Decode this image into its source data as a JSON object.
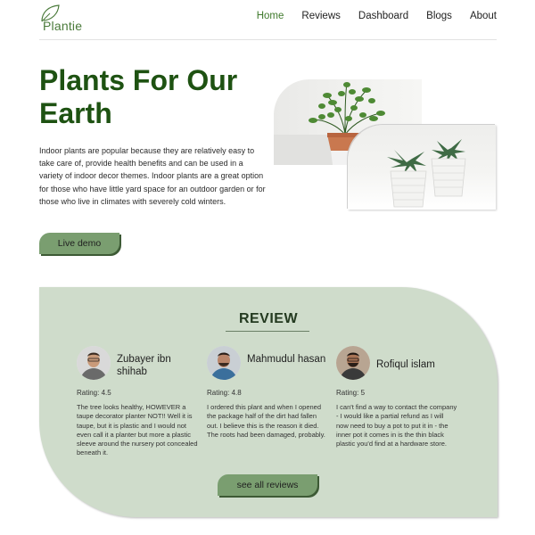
{
  "brand": {
    "name": "Plantie",
    "accent": "#1e5212",
    "button": "#7a9e70",
    "section_bg": "#cfdccb",
    "logo_icon": "leaf-icon"
  },
  "nav": {
    "items": [
      {
        "label": "Home",
        "active": true
      },
      {
        "label": "Reviews",
        "active": false
      },
      {
        "label": "Dashboard",
        "active": false
      },
      {
        "label": "Blogs",
        "active": false
      },
      {
        "label": "About",
        "active": false
      }
    ]
  },
  "hero": {
    "title": "Plants For Our Earth",
    "description": "Indoor plants are popular because they are relatively easy to take care of, provide health benefits and can be used in a variety of indoor decor themes. Indoor plants are a great option for those who have little yard space for an outdoor garden or for those who live in climates with severely cold winters.",
    "button_label": "Live demo"
  },
  "review": {
    "title": "REVIEW",
    "cards": [
      {
        "name": "Zubayer ibn shihab",
        "rating": "Rating: 4.5",
        "text": "The tree looks healthy, HOWEVER a taupe decorator planter NOT!! Well it is taupe, but it is plastic and I would not even call it a planter but more a plastic sleeve around the nursery pot concealed beneath it."
      },
      {
        "name": "Mahmudul hasan",
        "rating": "Rating: 4.8",
        "text": "I ordered this plant and when I opened the package half of the dirt had fallen out. I believe this is the reason it died. The roots had been damaged, probably."
      },
      {
        "name": "Rofiqul islam",
        "rating": "Rating: 5",
        "text": "I can't find a way to contact the company - I would like a partial refund as I will now need to buy a pot to put it in - the inner pot it comes in is the thin black plastic you'd find at a hardware store."
      }
    ],
    "button_label": "see all reviews"
  }
}
